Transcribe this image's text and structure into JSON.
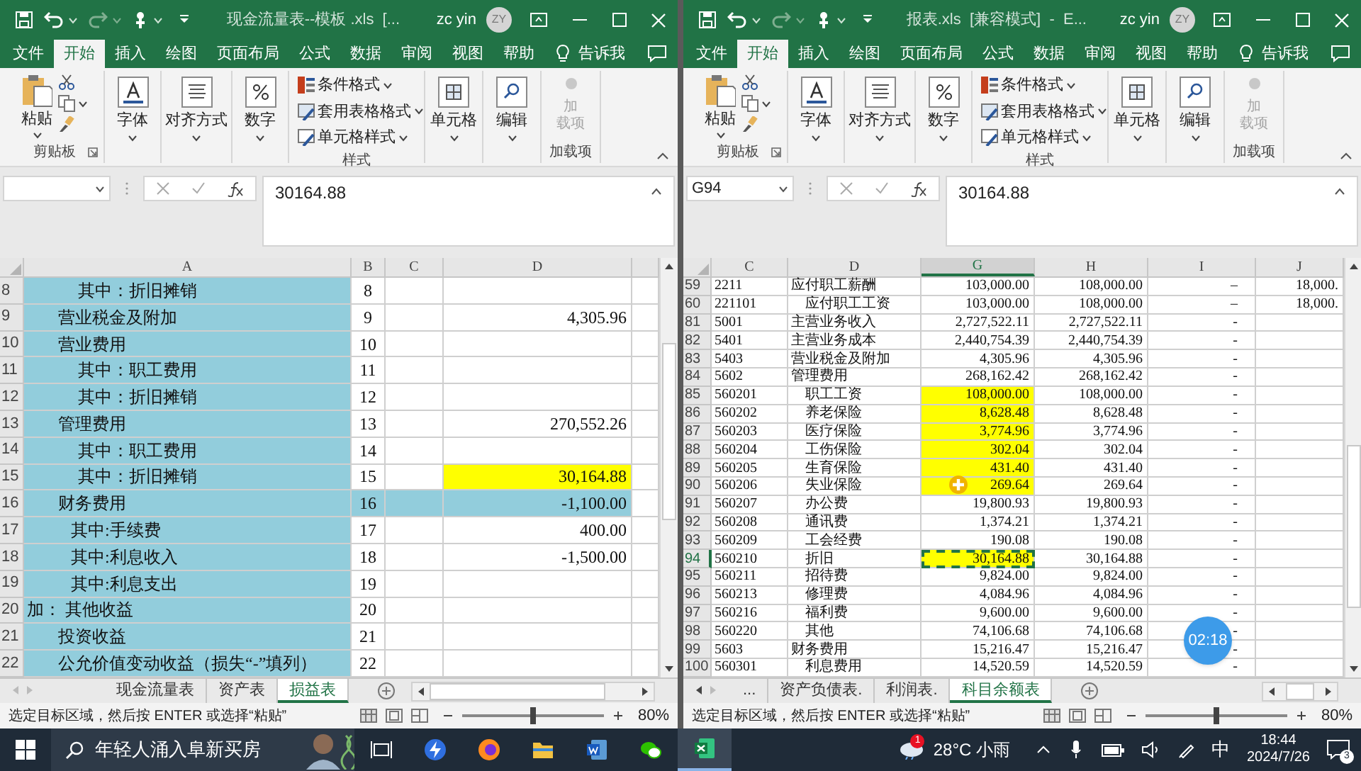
{
  "windows": [
    {
      "title": "现金流量表--模板 .xls  [...",
      "user": "zc yin",
      "avatar": "ZY",
      "menu_tabs": [
        {
          "label": "文件",
          "selected": false
        },
        {
          "label": "开始",
          "selected": true
        },
        {
          "label": "插入",
          "selected": false
        },
        {
          "label": "绘图",
          "selected": false
        },
        {
          "label": "页面布局",
          "selected": false
        },
        {
          "label": "公式",
          "selected": false
        },
        {
          "label": "数据",
          "selected": false
        },
        {
          "label": "审阅",
          "selected": false
        },
        {
          "label": "视图",
          "selected": false
        },
        {
          "label": "帮助",
          "selected": false
        }
      ],
      "tell_me": "告诉我",
      "ribbon": [
        {
          "kind": "clipboard",
          "label": "剪贴板",
          "button": "粘贴"
        },
        {
          "kind": "font",
          "button": "字体"
        },
        {
          "kind": "align",
          "button": "对齐方式"
        },
        {
          "kind": "number",
          "button": "数字"
        },
        {
          "kind": "styles",
          "label": "样式",
          "items": [
            "条件格式",
            "套用表格格式",
            "单元格样式"
          ]
        },
        {
          "kind": "cells",
          "button": "单元格"
        },
        {
          "kind": "edit",
          "button": "编辑"
        },
        {
          "kind": "addins",
          "label": "加载项",
          "button_lines": [
            "加",
            "载项"
          ],
          "disabled": true
        }
      ],
      "formula": "30164.88",
      "columns": [
        {
          "label": "A",
          "selected": false
        },
        {
          "label": "B",
          "selected": false
        },
        {
          "label": "C",
          "selected": false
        },
        {
          "label": "D",
          "selected": false
        },
        {
          "selected": false
        }
      ],
      "rows": [
        {
          "number": "8",
          "selected": false,
          "cells": [
            {
              "text": "其中：折旧摊销",
              "kind": "sub",
              "color": "#92cddc"
            },
            {
              "text": "8"
            },
            {},
            {},
            {}
          ]
        },
        {
          "number": "9",
          "selected": false,
          "cells": [
            {
              "text": "营业税金及附加",
              "kind": "main",
              "color": "#92cddc"
            },
            {
              "text": "9"
            },
            {},
            {
              "text": "4,305.96"
            },
            {}
          ]
        },
        {
          "number": "10",
          "selected": false,
          "cells": [
            {
              "text": "营业费用",
              "kind": "main",
              "color": "#92cddc"
            },
            {
              "text": "10"
            },
            {},
            {},
            {}
          ]
        },
        {
          "number": "11",
          "selected": false,
          "cells": [
            {
              "text": "其中：职工费用",
              "kind": "sub",
              "color": "#92cddc"
            },
            {
              "text": "11"
            },
            {},
            {},
            {}
          ]
        },
        {
          "number": "12",
          "selected": false,
          "cells": [
            {
              "text": "其中：折旧摊销",
              "kind": "sub",
              "color": "#92cddc"
            },
            {
              "text": "12"
            },
            {},
            {},
            {}
          ]
        },
        {
          "number": "13",
          "selected": false,
          "cells": [
            {
              "text": "管理费用",
              "kind": "main",
              "color": "#92cddc"
            },
            {
              "text": "13"
            },
            {},
            {
              "text": "270,552.26"
            },
            {}
          ]
        },
        {
          "number": "14",
          "selected": false,
          "cells": [
            {
              "text": "其中：职工费用",
              "kind": "sub",
              "color": "#92cddc"
            },
            {
              "text": "14"
            },
            {},
            {},
            {}
          ]
        },
        {
          "number": "15",
          "selected": false,
          "cells": [
            {
              "text": "其中：折旧摊销",
              "kind": "sub",
              "color": "#92cddc"
            },
            {
              "text": "15"
            },
            {},
            {
              "text": "30,164.88",
              "color": "#ffff00"
            },
            {}
          ]
        },
        {
          "number": "16",
          "selected": false,
          "cells": [
            {
              "text": "财务费用",
              "kind": "main",
              "color": "#92cddc"
            },
            {
              "text": "16",
              "color": "#92cddc"
            },
            {
              "color": "#92cddc"
            },
            {
              "text": "-1,100.00",
              "color": "#92cddc"
            },
            {}
          ]
        },
        {
          "number": "17",
          "selected": false,
          "cells": [
            {
              "text": "其中:手续费",
              "kind": "sub2",
              "color": "#92cddc"
            },
            {
              "text": "17"
            },
            {},
            {
              "text": "400.00"
            },
            {}
          ]
        },
        {
          "number": "18",
          "selected": false,
          "cells": [
            {
              "text": "其中:利息收入",
              "kind": "sub2",
              "color": "#92cddc"
            },
            {
              "text": "18"
            },
            {},
            {
              "text": "-1,500.00"
            },
            {}
          ]
        },
        {
          "number": "19",
          "selected": false,
          "cells": [
            {
              "text": "其中:利息支出",
              "kind": "sub2",
              "color": "#92cddc"
            },
            {
              "text": "19"
            },
            {},
            {},
            {}
          ]
        },
        {
          "number": "20",
          "selected": false,
          "cells": [
            {
              "text": "加：  其他收益",
              "kind": "plain",
              "color": "#92cddc"
            },
            {
              "text": "20"
            },
            {},
            {},
            {}
          ]
        },
        {
          "number": "21",
          "selected": false,
          "cells": [
            {
              "text": "投资收益",
              "kind": "main",
              "color": "#92cddc"
            },
            {
              "text": "21"
            },
            {},
            {},
            {}
          ]
        },
        {
          "number": "22",
          "selected": false,
          "cells": [
            {
              "text": "公允价值变动收益（损失“-”填列）",
              "kind": "main",
              "color": "#92cddc"
            },
            {
              "text": "22"
            },
            {},
            {},
            {}
          ]
        }
      ],
      "sheet_tabs": [
        {
          "label": "现金流量表",
          "selected": false
        },
        {
          "label": "资产表",
          "selected": false
        },
        {
          "label": "损益表",
          "selected": true
        }
      ],
      "status": "选定目标区域，然后按 ENTER 或选择“粘贴”",
      "zoom": {
        "level": 0.5,
        "reading": "80%"
      }
    },
    {
      "title": "报表.xls  [兼容模式]  -  E...",
      "user": "zc yin",
      "avatar": "ZY",
      "menu_tabs": [
        {
          "label": "文件",
          "selected": false
        },
        {
          "label": "开始",
          "selected": true
        },
        {
          "label": "插入",
          "selected": false
        },
        {
          "label": "绘图",
          "selected": false
        },
        {
          "label": "页面布局",
          "selected": false
        },
        {
          "label": "公式",
          "selected": false
        },
        {
          "label": "数据",
          "selected": false
        },
        {
          "label": "审阅",
          "selected": false
        },
        {
          "label": "视图",
          "selected": false
        },
        {
          "label": "帮助",
          "selected": false
        }
      ],
      "tell_me": "告诉我",
      "ribbon": [
        {
          "kind": "clipboard",
          "label": "剪贴板",
          "button": "粘贴"
        },
        {
          "kind": "font",
          "button": "字体"
        },
        {
          "kind": "align",
          "button": "对齐方式"
        },
        {
          "kind": "number",
          "button": "数字"
        },
        {
          "kind": "styles",
          "label": "样式",
          "items": [
            "条件格式",
            "套用表格格式",
            "单元格样式"
          ]
        },
        {
          "kind": "cells",
          "button": "单元格"
        },
        {
          "kind": "edit",
          "button": "编辑"
        },
        {
          "kind": "addins",
          "label": "加载项",
          "button_lines": [
            "加",
            "载项"
          ],
          "disabled": true
        }
      ],
      "name_box": "G94",
      "formula": "30164.88",
      "columns": [
        {
          "label": "C",
          "selected": false
        },
        {
          "label": "D",
          "selected": false
        },
        {
          "label": "G",
          "selected": true
        },
        {
          "label": "H",
          "selected": false
        },
        {
          "label": "I",
          "selected": false
        },
        {
          "label": "J",
          "selected": false
        }
      ],
      "rows": [
        {
          "number": "59",
          "selected": false,
          "cells": [
            {
              "text": "2211"
            },
            {
              "text": "应付职工薪酬",
              "kind": "plain"
            },
            {
              "text": "103,000.00"
            },
            {
              "text": "108,000.00"
            },
            {
              "text": "–"
            },
            {
              "text": "18,000."
            }
          ]
        },
        {
          "number": "60",
          "selected": false,
          "cells": [
            {
              "text": "221101"
            },
            {
              "text": "应付职工工资",
              "kind": "sub"
            },
            {
              "text": "103,000.00"
            },
            {
              "text": "108,000.00"
            },
            {
              "text": "–"
            },
            {
              "text": "18,000."
            }
          ]
        },
        {
          "number": "81",
          "selected": false,
          "cells": [
            {
              "text": "5001"
            },
            {
              "text": "主营业务收入",
              "kind": "plain"
            },
            {
              "text": "2,727,522.11"
            },
            {
              "text": "2,727,522.11"
            },
            {
              "text": "-"
            },
            {}
          ]
        },
        {
          "number": "82",
          "selected": false,
          "cells": [
            {
              "text": "5401"
            },
            {
              "text": "主营业务成本",
              "kind": "plain"
            },
            {
              "text": "2,440,754.39"
            },
            {
              "text": "2,440,754.39"
            },
            {
              "text": "-"
            },
            {}
          ]
        },
        {
          "number": "83",
          "selected": false,
          "cells": [
            {
              "text": "5403"
            },
            {
              "text": "营业税金及附加",
              "kind": "plain"
            },
            {
              "text": "4,305.96"
            },
            {
              "text": "4,305.96"
            },
            {
              "text": "-"
            },
            {}
          ]
        },
        {
          "number": "84",
          "selected": false,
          "cells": [
            {
              "text": "5602"
            },
            {
              "text": "管理费用",
              "kind": "plain"
            },
            {
              "text": "268,162.42"
            },
            {
              "text": "268,162.42"
            },
            {
              "text": "-"
            },
            {}
          ]
        },
        {
          "number": "85",
          "selected": false,
          "cells": [
            {
              "text": "560201"
            },
            {
              "text": "职工工资",
              "kind": "sub"
            },
            {
              "text": "108,000.00",
              "color": "#ffff00"
            },
            {
              "text": "108,000.00"
            },
            {
              "text": "-"
            },
            {}
          ]
        },
        {
          "number": "86",
          "selected": false,
          "cells": [
            {
              "text": "560202"
            },
            {
              "text": "养老保险",
              "kind": "sub"
            },
            {
              "text": "8,628.48",
              "color": "#ffff00"
            },
            {
              "text": "8,628.48"
            },
            {
              "text": "-"
            },
            {}
          ]
        },
        {
          "number": "87",
          "selected": false,
          "cells": [
            {
              "text": "560203"
            },
            {
              "text": "医疗保险",
              "kind": "sub"
            },
            {
              "text": "3,774.96",
              "color": "#ffff00"
            },
            {
              "text": "3,774.96"
            },
            {
              "text": "-"
            },
            {}
          ]
        },
        {
          "number": "88",
          "selected": false,
          "cells": [
            {
              "text": "560204"
            },
            {
              "text": "工伤保险",
              "kind": "sub"
            },
            {
              "text": "302.04",
              "color": "#ffff00"
            },
            {
              "text": "302.04"
            },
            {
              "text": "-"
            },
            {}
          ]
        },
        {
          "number": "89",
          "selected": false,
          "cells": [
            {
              "text": "560205"
            },
            {
              "text": "生育保险",
              "kind": "sub"
            },
            {
              "text": "431.40",
              "color": "#ffff00"
            },
            {
              "text": "431.40"
            },
            {
              "text": "-"
            },
            {}
          ]
        },
        {
          "number": "90",
          "selected": false,
          "cells": [
            {
              "text": "560206"
            },
            {
              "text": "失业保险",
              "kind": "sub"
            },
            {
              "text": "269.64",
              "color": "#ffff00"
            },
            {
              "text": "269.64"
            },
            {
              "text": "-"
            },
            {}
          ]
        },
        {
          "number": "91",
          "selected": false,
          "cells": [
            {
              "text": "560207"
            },
            {
              "text": "办公费",
              "kind": "sub"
            },
            {
              "text": "19,800.93"
            },
            {
              "text": "19,800.93"
            },
            {
              "text": "-"
            },
            {}
          ]
        },
        {
          "number": "92",
          "selected": false,
          "cells": [
            {
              "text": "560208"
            },
            {
              "text": "通讯费",
              "kind": "sub"
            },
            {
              "text": "1,374.21"
            },
            {
              "text": "1,374.21"
            },
            {
              "text": "-"
            },
            {}
          ]
        },
        {
          "number": "93",
          "selected": false,
          "cells": [
            {
              "text": "560209"
            },
            {
              "text": "工会经费",
              "kind": "sub"
            },
            {
              "text": "190.08"
            },
            {
              "text": "190.08"
            },
            {
              "text": "-"
            },
            {}
          ]
        },
        {
          "number": "94",
          "selected": true,
          "cells": [
            {
              "text": "560210"
            },
            {
              "text": "折旧",
              "kind": "sub"
            },
            {
              "text": "30,164.88",
              "color": "#ffff00",
              "selected": true
            },
            {
              "text": "30,164.88"
            },
            {
              "text": "-"
            },
            {}
          ]
        },
        {
          "number": "95",
          "selected": false,
          "cells": [
            {
              "text": "560211"
            },
            {
              "text": "招待费",
              "kind": "sub"
            },
            {
              "text": "9,824.00"
            },
            {
              "text": "9,824.00"
            },
            {
              "text": "-"
            },
            {}
          ]
        },
        {
          "number": "96",
          "selected": false,
          "cells": [
            {
              "text": "560213"
            },
            {
              "text": "修理费",
              "kind": "sub"
            },
            {
              "text": "4,084.96"
            },
            {
              "text": "4,084.96"
            },
            {
              "text": "-"
            },
            {}
          ]
        },
        {
          "number": "97",
          "selected": false,
          "cells": [
            {
              "text": "560216"
            },
            {
              "text": "福利费",
              "kind": "sub"
            },
            {
              "text": "9,600.00"
            },
            {
              "text": "9,600.00"
            },
            {
              "text": "-"
            },
            {}
          ]
        },
        {
          "number": "98",
          "selected": false,
          "cells": [
            {
              "text": "560220"
            },
            {
              "text": "其他",
              "kind": "sub"
            },
            {
              "text": "74,106.68"
            },
            {
              "text": "74,106.68"
            },
            {
              "text": "-"
            },
            {}
          ]
        },
        {
          "number": "99",
          "selected": false,
          "cells": [
            {
              "text": "5603"
            },
            {
              "text": "财务费用",
              "kind": "plain"
            },
            {
              "text": "15,216.47"
            },
            {
              "text": "15,216.47"
            },
            {
              "text": "-"
            },
            {}
          ]
        },
        {
          "number": "100",
          "selected": false,
          "cells": [
            {
              "text": "560301"
            },
            {
              "text": "利息费用",
              "kind": "sub"
            },
            {
              "text": "14,520.59"
            },
            {
              "text": "14,520.59"
            },
            {
              "text": "-"
            },
            {}
          ]
        }
      ],
      "sheet_tabs": [
        {
          "label": "...",
          "selected": false
        },
        {
          "label": "资产负债表.",
          "selected": false
        },
        {
          "label": "利润表.",
          "selected": false
        },
        {
          "label": "科目余额表",
          "selected": true
        }
      ],
      "status": "选定目标区域，然后按 ENTER 或选择“粘贴”",
      "zoom": {
        "level": 0.5,
        "reading": "80%"
      }
    }
  ],
  "timer": "02:18",
  "taskbar": {
    "search": "年轻人涌入阜新买房",
    "apps": [
      {
        "kind": "taskview",
        "active": false
      },
      {
        "kind": "bolt",
        "active": false
      },
      {
        "kind": "firefox",
        "active": false
      },
      {
        "kind": "folder",
        "active": false
      },
      {
        "kind": "word",
        "active": false
      },
      {
        "kind": "wechat",
        "active": false
      },
      {
        "kind": "excel",
        "active": true
      }
    ],
    "weather_badge": "1",
    "weather": "28°C 小雨",
    "ime": "中",
    "time": "18:44",
    "date": "2024/7/26",
    "notifications": "3"
  }
}
